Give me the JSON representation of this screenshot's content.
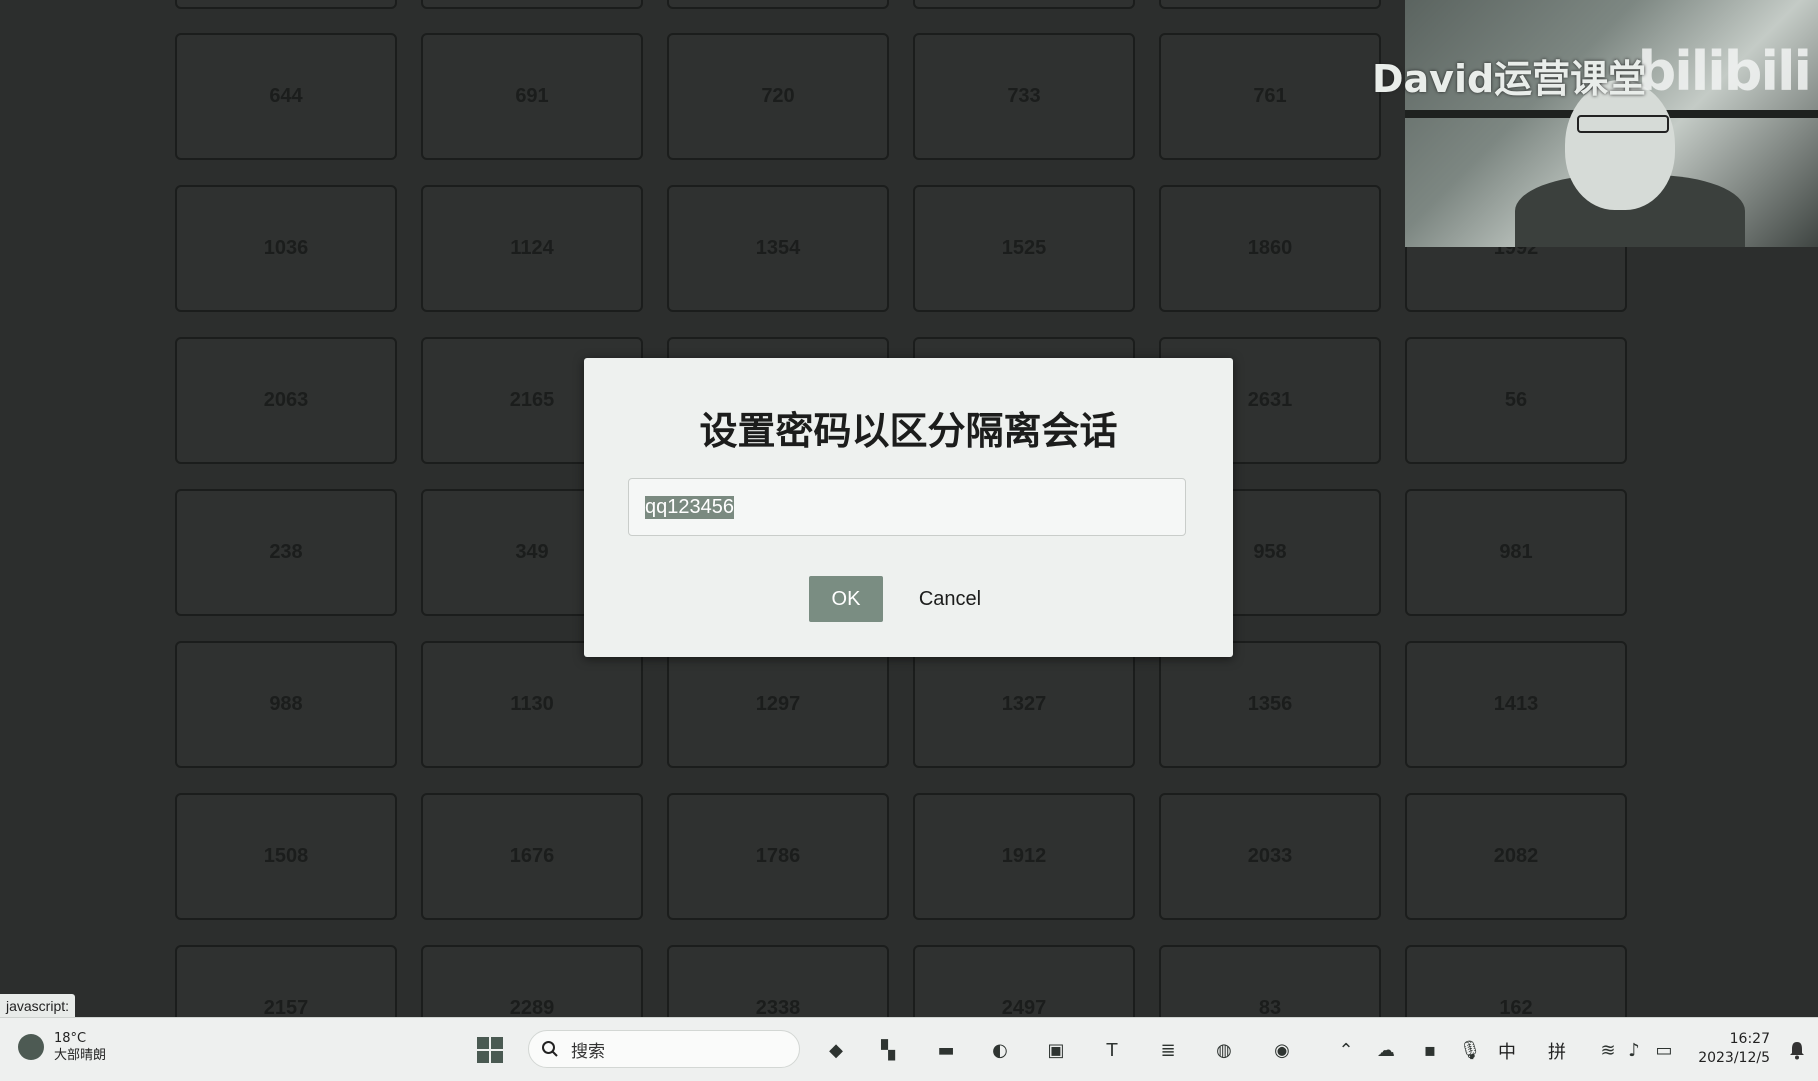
{
  "tiles": [
    [
      "644",
      "691",
      "720",
      "733",
      "761",
      ""
    ],
    [
      "1036",
      "1124",
      "1354",
      "1525",
      "1860",
      "1992"
    ],
    [
      "2063",
      "2165",
      "",
      "",
      "2631",
      "56"
    ],
    [
      "238",
      "349",
      "",
      "",
      "958",
      "981"
    ],
    [
      "988",
      "1130",
      "1297",
      "1327",
      "1356",
      "1413"
    ],
    [
      "1508",
      "1676",
      "1786",
      "1912",
      "2033",
      "2082"
    ],
    [
      "2157",
      "2289",
      "2338",
      "2497",
      "83",
      "162"
    ]
  ],
  "webcam": {
    "watermark": "David运营课堂",
    "logo": "bilibili"
  },
  "dialog": {
    "title": "设置密码以区分隔离会话",
    "input_value": "qq123456",
    "ok_label": "OK",
    "cancel_label": "Cancel"
  },
  "status_bar": {
    "text": "javascript:"
  },
  "taskbar": {
    "weather": {
      "temp": "18°C",
      "condition": "大部晴朗"
    },
    "search_label": "搜索",
    "ime_lang": "中",
    "ime_mode": "拼",
    "time": "16:27",
    "date": "2023/12/5",
    "icons": [
      "windows-start",
      "search",
      "photos",
      "pre",
      "terminal",
      "folder",
      "edge",
      "app",
      "typora",
      "notepad",
      "chrome",
      "dev-browser"
    ]
  },
  "colors": {
    "accent": "#7a8d82",
    "background": "#2c2e2d",
    "dialog_bg": "#eef1ef"
  }
}
